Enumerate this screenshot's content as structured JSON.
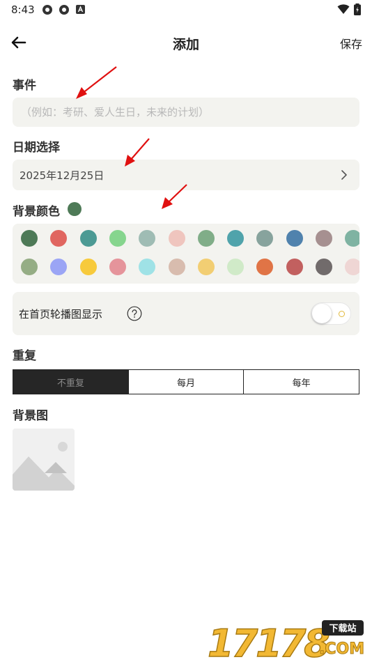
{
  "status_bar": {
    "time": "8:43"
  },
  "header": {
    "title": "添加",
    "save_label": "保存"
  },
  "event": {
    "label": "事件",
    "placeholder": "（例如：考研、爱人生日，未来的计划）",
    "value": ""
  },
  "date": {
    "label": "日期选择",
    "value": "2025年12月25日"
  },
  "background_color": {
    "label": "背景颜色",
    "selected": "#4e7a57",
    "row1": [
      "#4e7a57",
      "#e06660",
      "#4c9a94",
      "#86d58e",
      "#9fbcb4",
      "#efc5be",
      "#80ad88",
      "#50a3ab",
      "#87a39d",
      "#5082ad",
      "#a69090",
      "#7fb3a2"
    ],
    "row2": [
      "#95ad85",
      "#9ba5f5",
      "#f7ca3c",
      "#e5949b",
      "#9fe2e6",
      "#d8bcae",
      "#f2ce73",
      "#d0eac8",
      "#e07446",
      "#c2605f",
      "#716b6b",
      "#efd6d4"
    ]
  },
  "carousel": {
    "label": "在首页轮播图显示",
    "enabled": false
  },
  "repeat": {
    "label": "重复",
    "options": [
      "不重复",
      "每月",
      "每年"
    ],
    "selected_index": 0
  },
  "background_image": {
    "label": "背景图"
  },
  "watermark": {
    "digits": "17178",
    "badge": "下载站",
    "domain": ".COM"
  }
}
